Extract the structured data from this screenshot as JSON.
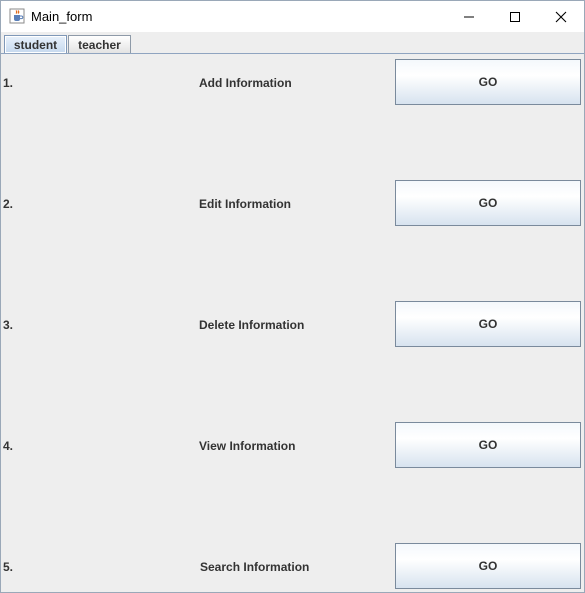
{
  "window": {
    "title": "Main_form",
    "icon": "java-cup-icon",
    "controls": {
      "minimize": "minimize-icon",
      "maximize": "maximize-icon",
      "close": "close-icon"
    }
  },
  "tabs": [
    {
      "label": "student",
      "selected": true
    },
    {
      "label": "teacher",
      "selected": false
    }
  ],
  "rows": [
    {
      "number": "1.",
      "label": "Add Information",
      "button": "GO"
    },
    {
      "number": "2.",
      "label": "Edit Information",
      "button": "GO"
    },
    {
      "number": "3.",
      "label": "Delete Information",
      "button": "GO"
    },
    {
      "number": "4.",
      "label": "View Information",
      "button": "GO"
    },
    {
      "number": "5.",
      "label": "Search Information",
      "button": "GO"
    }
  ],
  "colors": {
    "background": "#eeeeee",
    "selected_tab": "#c6d9ee",
    "button_border": "#7a8a9c"
  }
}
